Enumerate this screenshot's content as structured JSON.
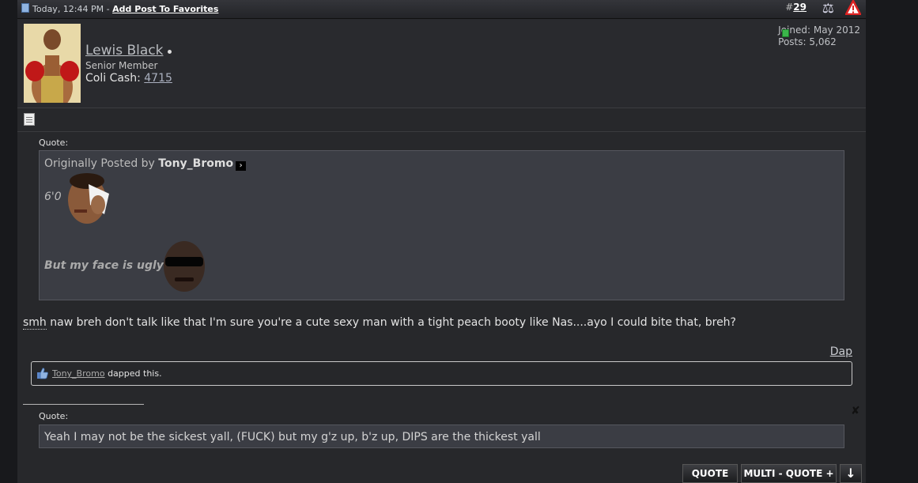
{
  "header": {
    "timestamp": "Today, 12:44 PM",
    "separator": " - ",
    "favorites_link": "Add Post To Favorites",
    "post_number_prefix": "#",
    "post_number": "29",
    "scale_icon": "scale-icon",
    "warning_icon": "warning-icon"
  },
  "user": {
    "name": "Lewis Black",
    "title": "Senior Member",
    "coli_cash_label": "Coli Cash: ",
    "coli_cash_value": "4715",
    "joined": "Joined: May 2012",
    "posts": "Posts: 5,062",
    "online_icon": "online-dot-icon"
  },
  "quote_label": "Quote:",
  "quote1": {
    "originally_prefix": "Originally Posted by ",
    "author": "Tony_Bromo",
    "line1": "6'0",
    "line2": "But my face is ugly"
  },
  "post_body": {
    "smh": "smh",
    "text": " naw breh don't talk like that I'm sure you're a cute sexy man with a tight peach booty like Nas....ayo I could bite that, breh?"
  },
  "dap": {
    "link": "Dap",
    "user": "Tony_Bromo",
    "suffix": " dapped this."
  },
  "quote2": {
    "text": "Yeah I may not be the sickest yall, (FUCK) but my g'z up, b'z up, DIPS are the thickest yall"
  },
  "buttons": {
    "quote": "QUOTE",
    "multi_quote": "MULTI - QUOTE +",
    "down": "↓"
  },
  "colors": {
    "background": "#18191c",
    "post_bg": "#27282b",
    "quote_bg": "#3b3d44",
    "rep_green": "#3bb54a"
  }
}
